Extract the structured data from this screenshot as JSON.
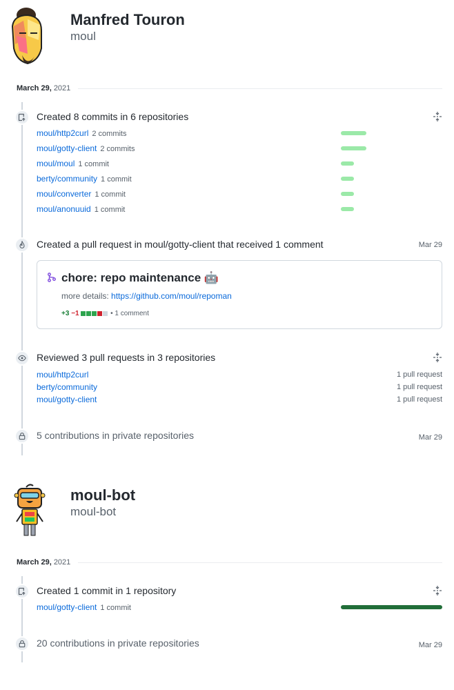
{
  "users": [
    {
      "name": "Manfred Touron",
      "login": "moul",
      "date": {
        "day": "March 29,",
        "year": "2021"
      },
      "commits_event": {
        "title": "Created 8 commits in 6 repositories",
        "repos": [
          {
            "name": "moul/http2curl",
            "count": "2 commits",
            "share": 1.0
          },
          {
            "name": "moul/gotty-client",
            "count": "2 commits",
            "share": 1.0
          },
          {
            "name": "moul/moul",
            "count": "1 commit",
            "share": 0.5
          },
          {
            "name": "berty/community",
            "count": "1 commit",
            "share": 0.5
          },
          {
            "name": "moul/converter",
            "count": "1 commit",
            "share": 0.5
          },
          {
            "name": "moul/anonuuid",
            "count": "1 commit",
            "share": 0.5
          }
        ]
      },
      "pr_event": {
        "title": "Created a pull request in moul/gotty-client that received 1 comment",
        "date": "Mar 29",
        "pr_title": "chore: repo maintenance 🤖",
        "details_label": "more details:",
        "details_link": "https://github.com/moul/repoman",
        "additions": "+3",
        "deletions": "−1",
        "comments": "• 1 comment"
      },
      "review_event": {
        "title": "Reviewed 3 pull requests in 3 repositories",
        "repos": [
          {
            "name": "moul/http2curl",
            "count": "1 pull request"
          },
          {
            "name": "berty/community",
            "count": "1 pull request"
          },
          {
            "name": "moul/gotty-client",
            "count": "1 pull request"
          }
        ]
      },
      "private_event": {
        "title": "5 contributions in private repositories",
        "date": "Mar 29"
      }
    },
    {
      "name": "moul-bot",
      "login": "moul-bot",
      "date": {
        "day": "March 29,",
        "year": "2021"
      },
      "commits_event": {
        "title": "Created 1 commit in 1 repository",
        "repos": [
          {
            "name": "moul/gotty-client",
            "count": "1 commit",
            "share": 1.0
          }
        ]
      },
      "private_event": {
        "title": "20 contributions in private repositories",
        "date": "Mar 29"
      }
    }
  ],
  "colors": {
    "link": "#0969da",
    "bar_light": "#9be9a8",
    "bar_dark": "#216e39",
    "add": "#1a7f37",
    "del": "#cf222e"
  }
}
